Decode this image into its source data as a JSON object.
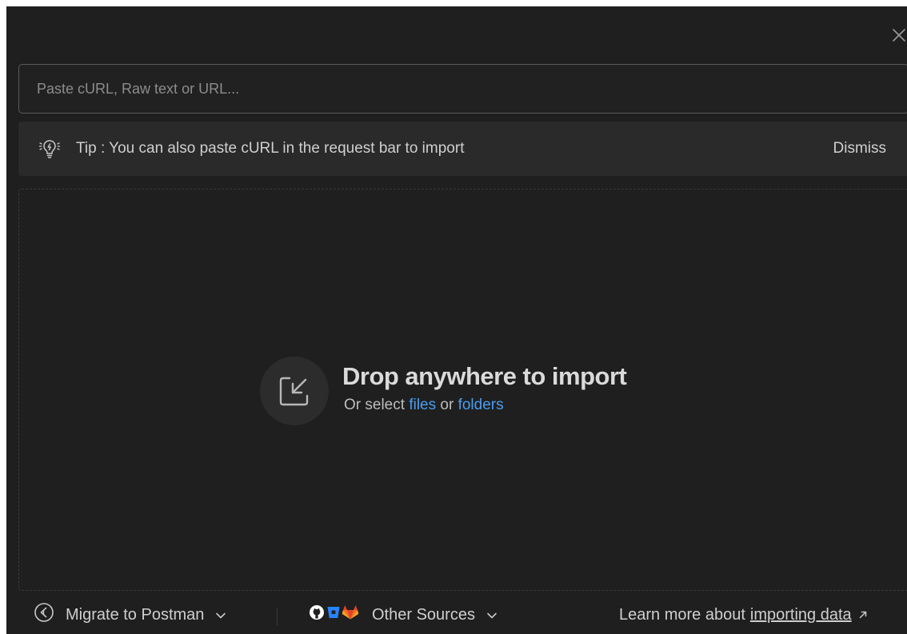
{
  "input": {
    "placeholder": "Paste cURL, Raw text or URL..."
  },
  "tip": {
    "text": "Tip : You can also paste cURL in the request bar to import",
    "dismiss_label": "Dismiss",
    "icon": "lightbulb-icon"
  },
  "drop": {
    "title": "Drop anywhere to import",
    "sub_prefix": "Or select",
    "files_link": "files",
    "or_text": "or",
    "folders_link": "folders",
    "icon": "import-arrow-icon"
  },
  "footer": {
    "migrate_label": "Migrate to Postman",
    "sources_label": "Other Sources",
    "learn_prefix": "Learn more about",
    "learn_link": "importing data"
  },
  "colors": {
    "background": "#1f1f1f",
    "link": "#4a9df0",
    "github": "#ffffff",
    "bitbucket": "#2684ff",
    "gitlab": "#fc6d26"
  }
}
